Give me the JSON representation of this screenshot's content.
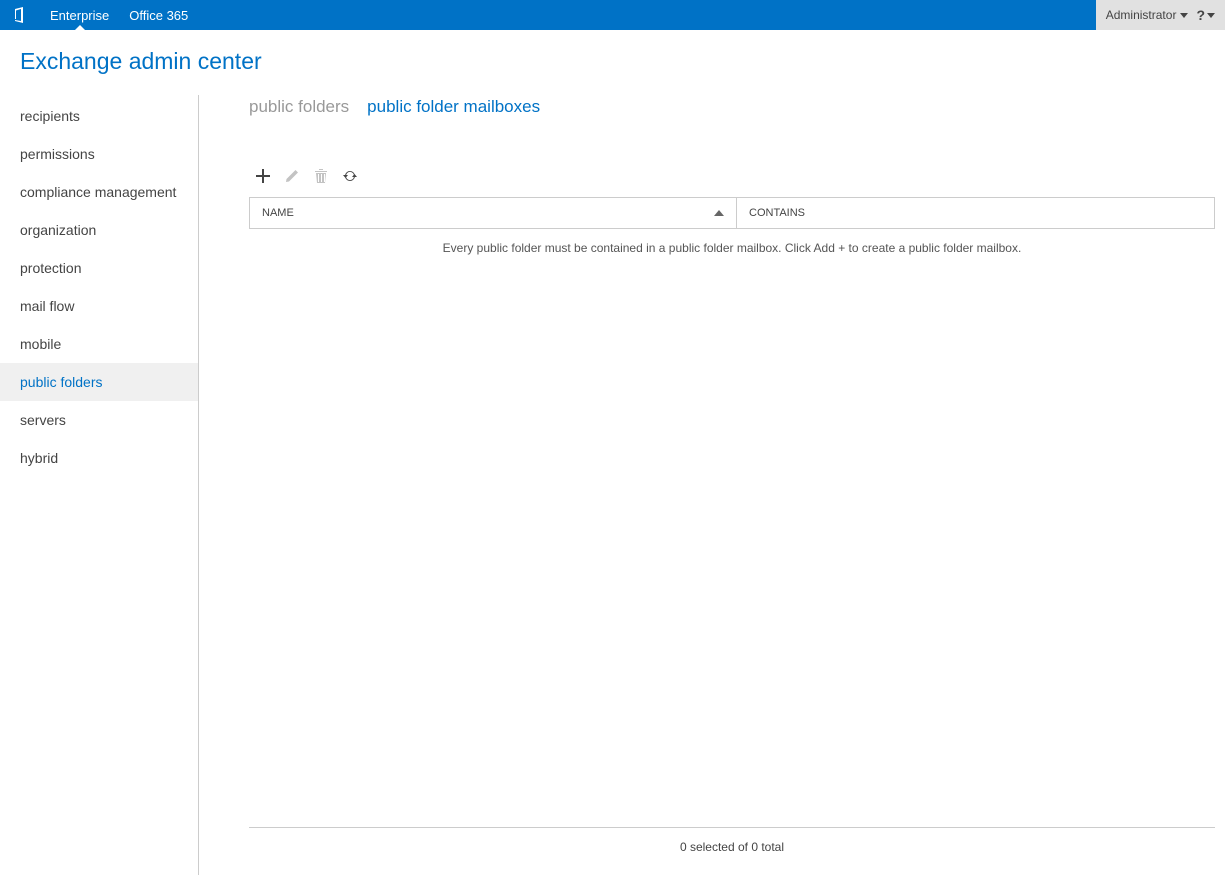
{
  "topbar": {
    "tabs": [
      {
        "label": "Enterprise",
        "active": true
      },
      {
        "label": "Office 365",
        "active": false
      }
    ],
    "admin_label": "Administrator",
    "help_label": "?"
  },
  "app_title": "Exchange admin center",
  "sidebar": {
    "items": [
      {
        "label": "recipients",
        "active": false
      },
      {
        "label": "permissions",
        "active": false
      },
      {
        "label": "compliance management",
        "active": false
      },
      {
        "label": "organization",
        "active": false
      },
      {
        "label": "protection",
        "active": false
      },
      {
        "label": "mail flow",
        "active": false
      },
      {
        "label": "mobile",
        "active": false
      },
      {
        "label": "public folders",
        "active": true
      },
      {
        "label": "servers",
        "active": false
      },
      {
        "label": "hybrid",
        "active": false
      }
    ]
  },
  "content": {
    "tabs": [
      {
        "label": "public folders",
        "active": false
      },
      {
        "label": "public folder mailboxes",
        "active": true
      }
    ],
    "columns": {
      "name": "NAME",
      "contains": "CONTAINS"
    },
    "empty_message": "Every public folder must be contained in a public folder mailbox. Click Add + to create a public folder mailbox.",
    "status": "0 selected of 0 total"
  }
}
